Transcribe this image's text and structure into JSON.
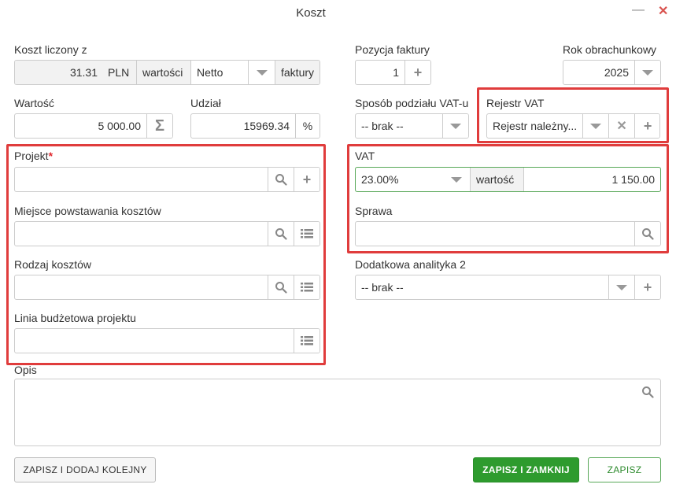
{
  "window": {
    "title": "Koszt"
  },
  "fields": {
    "koszt_liczony": {
      "label": "Koszt liczony z",
      "value": "31.31",
      "currency": "PLN",
      "mid_label": "wartości",
      "select": "Netto",
      "suffix": "faktury"
    },
    "pozycja": {
      "label": "Pozycja faktury",
      "value": "1"
    },
    "rok": {
      "label": "Rok obrachunkowy",
      "value": "2025"
    },
    "wartosc": {
      "label": "Wartość",
      "value": "5 000.00"
    },
    "udzial": {
      "label": "Udział",
      "value": "15969.34",
      "unit": "%"
    },
    "sposob": {
      "label": "Sposób podziału VAT-u",
      "value": "-- brak --"
    },
    "rejestr": {
      "label": "Rejestr VAT",
      "value": "Rejestr należny..."
    },
    "projekt": {
      "label": "Projekt",
      "required_mark": "*",
      "value": ""
    },
    "vat": {
      "label": "VAT",
      "rate": "23.00%",
      "mid_label": "wartość",
      "value": "1 150.00"
    },
    "miejsce": {
      "label": "Miejsce powstawania kosztów",
      "value": ""
    },
    "sprawa": {
      "label": "Sprawa",
      "value": ""
    },
    "rodzaj": {
      "label": "Rodzaj kosztów",
      "value": ""
    },
    "analityka": {
      "label": "Dodatkowa analityka 2",
      "value": "-- brak --"
    },
    "linia": {
      "label": "Linia budżetowa projektu",
      "value": ""
    },
    "opis": {
      "label": "Opis",
      "value": ""
    }
  },
  "buttons": {
    "save_add": "ZAPISZ I DODAJ KOLEJNY",
    "save_close": "ZAPISZ I ZAMKNIJ",
    "save": "ZAPISZ"
  },
  "icons": {
    "minimize": "—",
    "close": "✕",
    "plus": "+",
    "clear": "✕",
    "sigma": "Σ"
  },
  "colors": {
    "accent": "#2e9b2e",
    "highlight": "#e03c3c",
    "required": "#e0282e"
  }
}
